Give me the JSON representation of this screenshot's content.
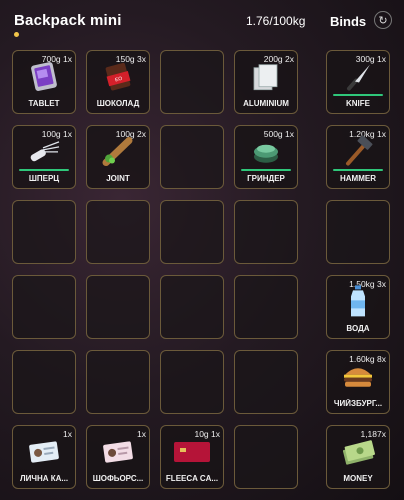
{
  "header": {
    "title": "Backpack mini",
    "weight": "1.76/100kg",
    "binds_title": "Binds"
  },
  "colors": {
    "durability_bar": "#2fc77a",
    "slot_border": "#6b5a3a"
  },
  "inventory": [
    {
      "qty": "700g 1x",
      "label": "TABLET",
      "icon": "tablet-icon"
    },
    {
      "qty": "150g 3x",
      "label": "ШОКОЛАД",
      "icon": "chocolate-icon"
    },
    null,
    {
      "qty": "200g 2x",
      "label": "ALUMINIUM",
      "icon": "aluminium-icon"
    },
    {
      "qty": "100g 1x",
      "label": "ШПЕРЦ",
      "icon": "lockpick-icon",
      "durability": 1.0
    },
    {
      "qty": "100g 2x",
      "label": "JOINT",
      "icon": "joint-icon"
    },
    null,
    {
      "qty": "500g 1x",
      "label": "ГРИНДЕР",
      "icon": "grinder-icon",
      "durability": 1.0
    },
    null,
    null,
    null,
    null,
    null,
    null,
    null,
    null,
    null,
    null,
    null,
    null,
    {
      "qty": "1x",
      "label": "ЛИЧНА КА...",
      "icon": "id-card-icon"
    },
    {
      "qty": "1x",
      "label": "ШОФЬОРС...",
      "icon": "driver-license-icon"
    },
    {
      "qty": "10g 1x",
      "label": "FLEECA CA...",
      "icon": "bank-card-icon"
    },
    null
  ],
  "binds": [
    {
      "qty": "300g 1x",
      "label": "KNIFE",
      "icon": "knife-icon",
      "durability": 1.0
    },
    {
      "qty": "1.20kg 1x",
      "label": "HAMMER",
      "icon": "hammer-icon",
      "durability": 1.0
    },
    null,
    {
      "qty": "1.50kg 3x",
      "label": "ВОДА",
      "icon": "water-bottle-icon"
    },
    {
      "qty": "1.60kg 8x",
      "label": "ЧИЙЗБУРГ...",
      "icon": "cheeseburger-icon"
    },
    {
      "qty": "1,187x",
      "label": "MONEY",
      "icon": "money-icon"
    }
  ]
}
